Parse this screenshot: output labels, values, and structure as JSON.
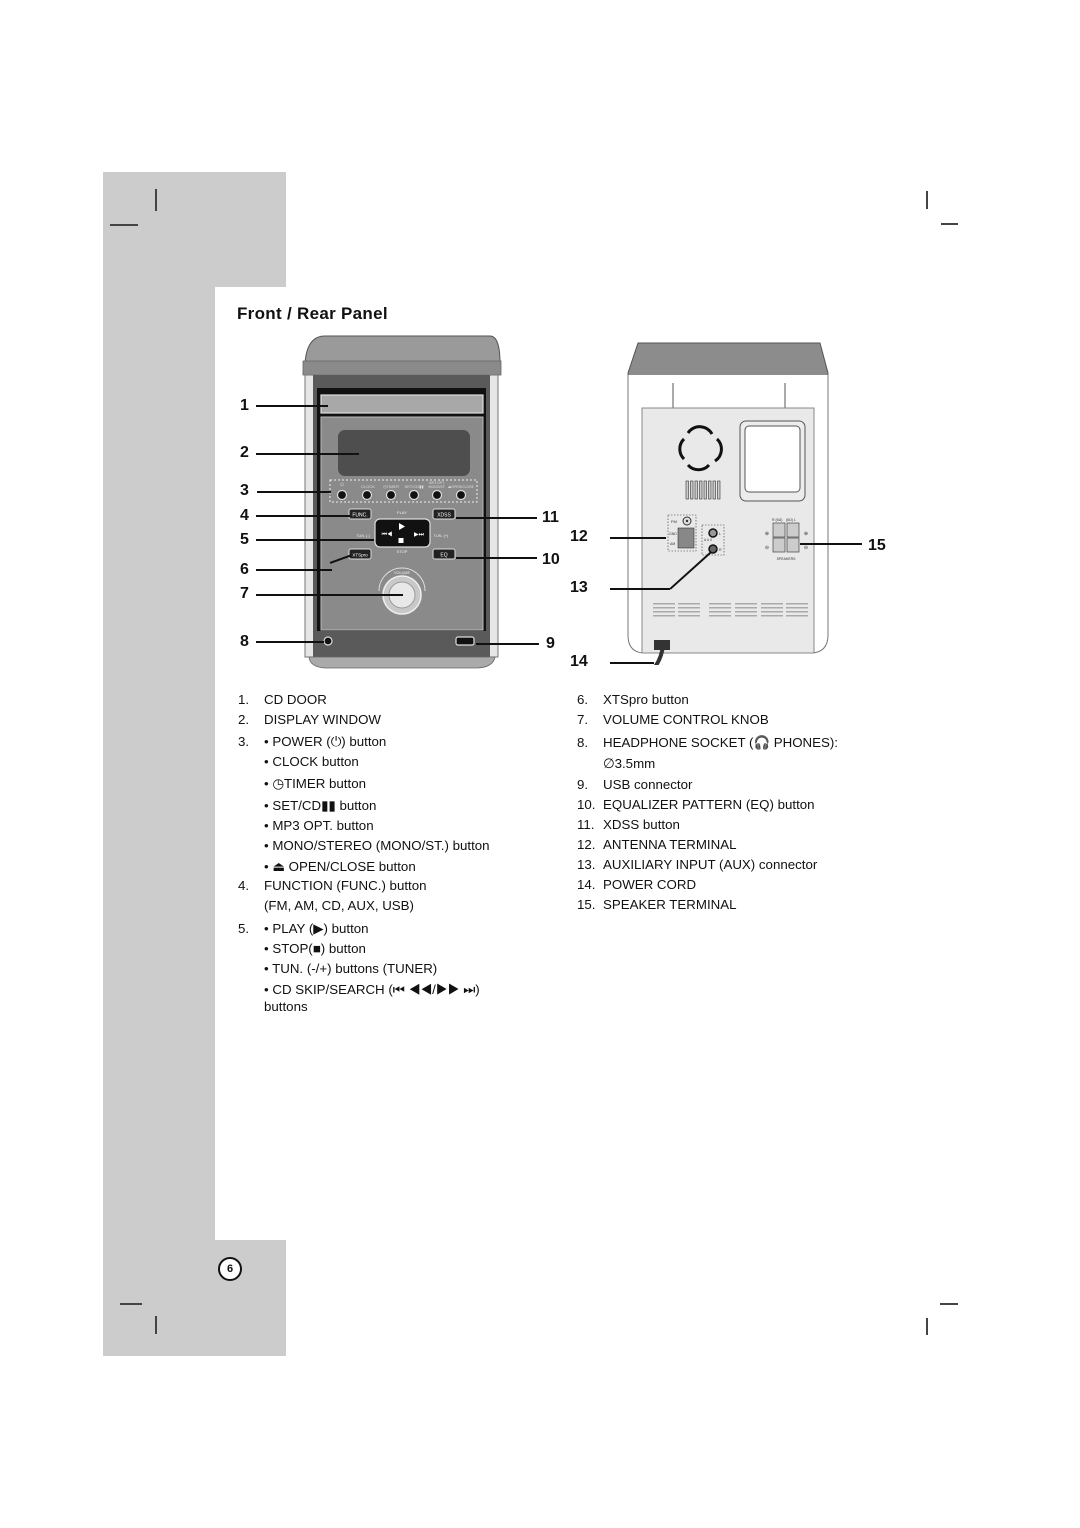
{
  "page": {
    "title": "Front / Rear Panel",
    "page_number": "6"
  },
  "front_panel": {
    "labels": {
      "power": "⏻",
      "clock": "CLOCK",
      "timer": "◷TIMER",
      "set_cd": "SET/CD▮▮",
      "mp3_opt": "MP3 OPT.",
      "mono_st": "MONO/ST.",
      "open_close": "⏏OPEN/CLOSE",
      "func": "FUNC.",
      "xdss": "XDSS",
      "play": "PLAY",
      "stop": "STOP",
      "tun_minus": "TUN. (-)",
      "tun_plus": "TUN. (+)",
      "xtspro": "XTSpro",
      "eq": "EQ",
      "volume": "VOLUME"
    },
    "callouts": [
      "1",
      "2",
      "3",
      "4",
      "5",
      "6",
      "7",
      "8",
      "9",
      "10",
      "11"
    ]
  },
  "rear_panel": {
    "labels": {
      "fm": "FM",
      "gnd": "GND",
      "am": "AM",
      "aux_letters": "A U X",
      "aux_l": "L",
      "aux_r": "R",
      "speaker_r": "R (6Ω)",
      "speaker_l": "(6Ω) L",
      "speakers": "SPEAKERS"
    },
    "callouts": [
      "12",
      "13",
      "14",
      "15"
    ]
  },
  "legend_left": [
    {
      "num": "1.",
      "text": "CD DOOR"
    },
    {
      "num": "2.",
      "text": "DISPLAY WINDOW"
    },
    {
      "num": "3.",
      "text": "• POWER (⏻) button"
    },
    {
      "num": "",
      "text": "• CLOCK button"
    },
    {
      "num": "",
      "text": "• ◷TIMER button"
    },
    {
      "num": "",
      "text": "• SET/CD▮▮ button"
    },
    {
      "num": "",
      "text": "• MP3 OPT. button"
    },
    {
      "num": "",
      "text": "• MONO/STEREO (MONO/ST.) button"
    },
    {
      "num": "",
      "text": "• ⏏ OPEN/CLOSE button"
    },
    {
      "num": "4.",
      "text": "FUNCTION (FUNC.) button"
    },
    {
      "num": "",
      "text": "(FM, AM, CD, AUX, USB)"
    },
    {
      "num": "5.",
      "text": "• PLAY (▶) button"
    },
    {
      "num": "",
      "text": "• STOP(■) button"
    },
    {
      "num": "",
      "text": "• TUN. (-/+) buttons (TUNER)"
    },
    {
      "num": "",
      "text": "• CD SKIP/SEARCH (⏮ ◀◀/▶▶ ⏭)"
    },
    {
      "num": "",
      "text": "buttons"
    }
  ],
  "legend_right": [
    {
      "num": "6.",
      "text": "XTSpro button"
    },
    {
      "num": "7.",
      "text": "VOLUME CONTROL KNOB"
    },
    {
      "num": "8.",
      "text": "HEADPHONE SOCKET (🎧 PHONES):"
    },
    {
      "num": "",
      "text": "∅3.5mm"
    },
    {
      "num": "9.",
      "text": "USB connector"
    },
    {
      "num": "10.",
      "text": "EQUALIZER PATTERN (EQ) button"
    },
    {
      "num": "11.",
      "text": "XDSS button"
    },
    {
      "num": "12.",
      "text": "ANTENNA TERMINAL"
    },
    {
      "num": "13.",
      "text": "AUXILIARY INPUT (AUX) connector"
    },
    {
      "num": "14.",
      "text": "POWER CORD"
    },
    {
      "num": "15.",
      "text": "SPEAKER TERMINAL"
    }
  ]
}
